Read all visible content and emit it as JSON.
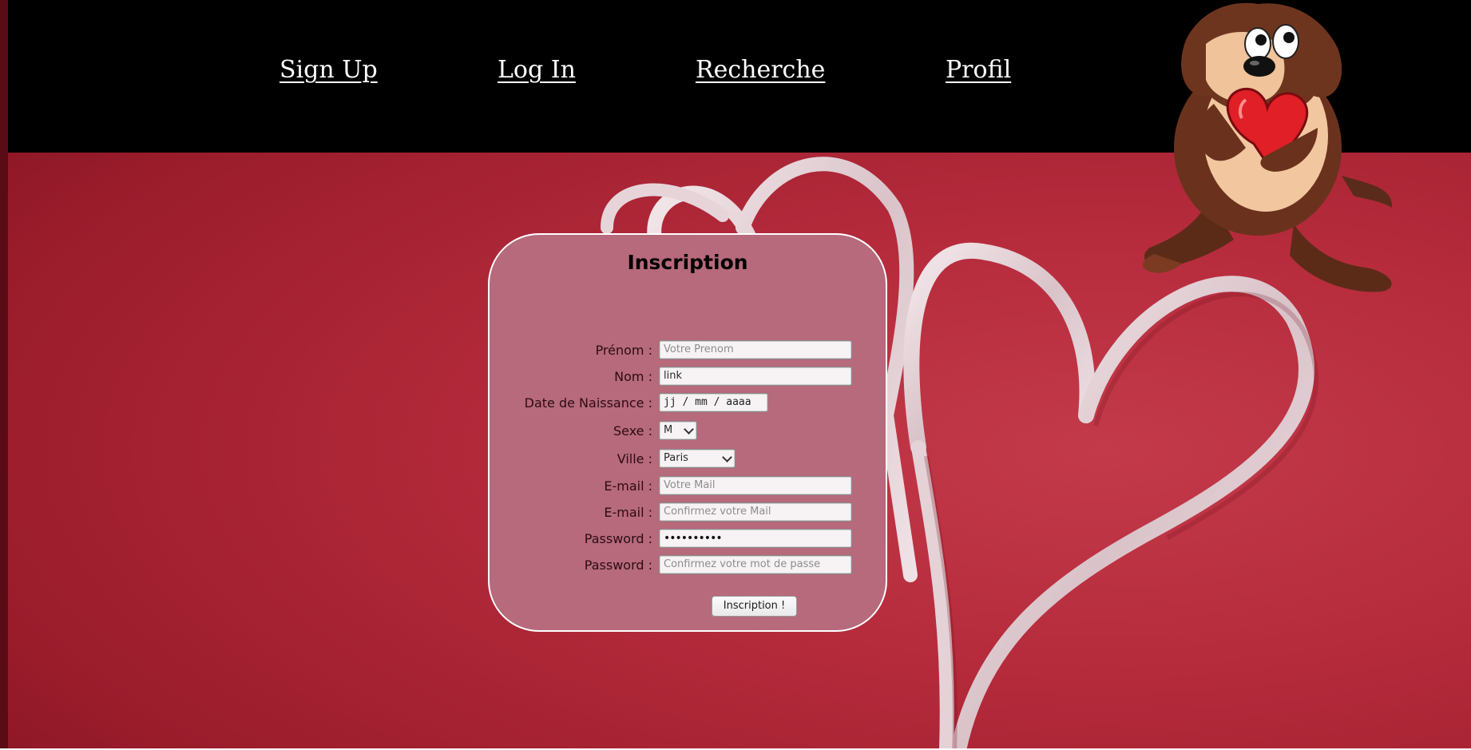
{
  "nav": {
    "items": [
      {
        "label": "Sign Up"
      },
      {
        "label": "Log In"
      },
      {
        "label": "Recherche"
      },
      {
        "label": "Profil"
      }
    ]
  },
  "form": {
    "title": "Inscription",
    "fields": {
      "prenom": {
        "label": "Prénom :",
        "placeholder": "Votre Prenom",
        "value": ""
      },
      "nom": {
        "label": "Nom :",
        "placeholder": "",
        "value": "link"
      },
      "naissance": {
        "label": "Date de Naissance :",
        "value": "jj / mm / aaaa"
      },
      "sexe": {
        "label": "Sexe :",
        "value": "M"
      },
      "ville": {
        "label": "Ville :",
        "value": "Paris"
      },
      "email": {
        "label": "E-mail :",
        "placeholder": "Votre Mail",
        "value": ""
      },
      "email_confirm": {
        "label": "E-mail :",
        "placeholder": "Confirmez votre Mail",
        "value": ""
      },
      "password": {
        "label": "Password :",
        "value": "••••••••••"
      },
      "password_confirm": {
        "label": "Password :",
        "placeholder": "Confirmez votre mot de passe",
        "value": ""
      }
    },
    "submit_label": "Inscription !"
  },
  "colors": {
    "navbar": "#000000",
    "panel": "#b66a7c",
    "background": "#b52b3c"
  },
  "icons": {
    "mascot": "cartoon-devil-holding-heart"
  }
}
